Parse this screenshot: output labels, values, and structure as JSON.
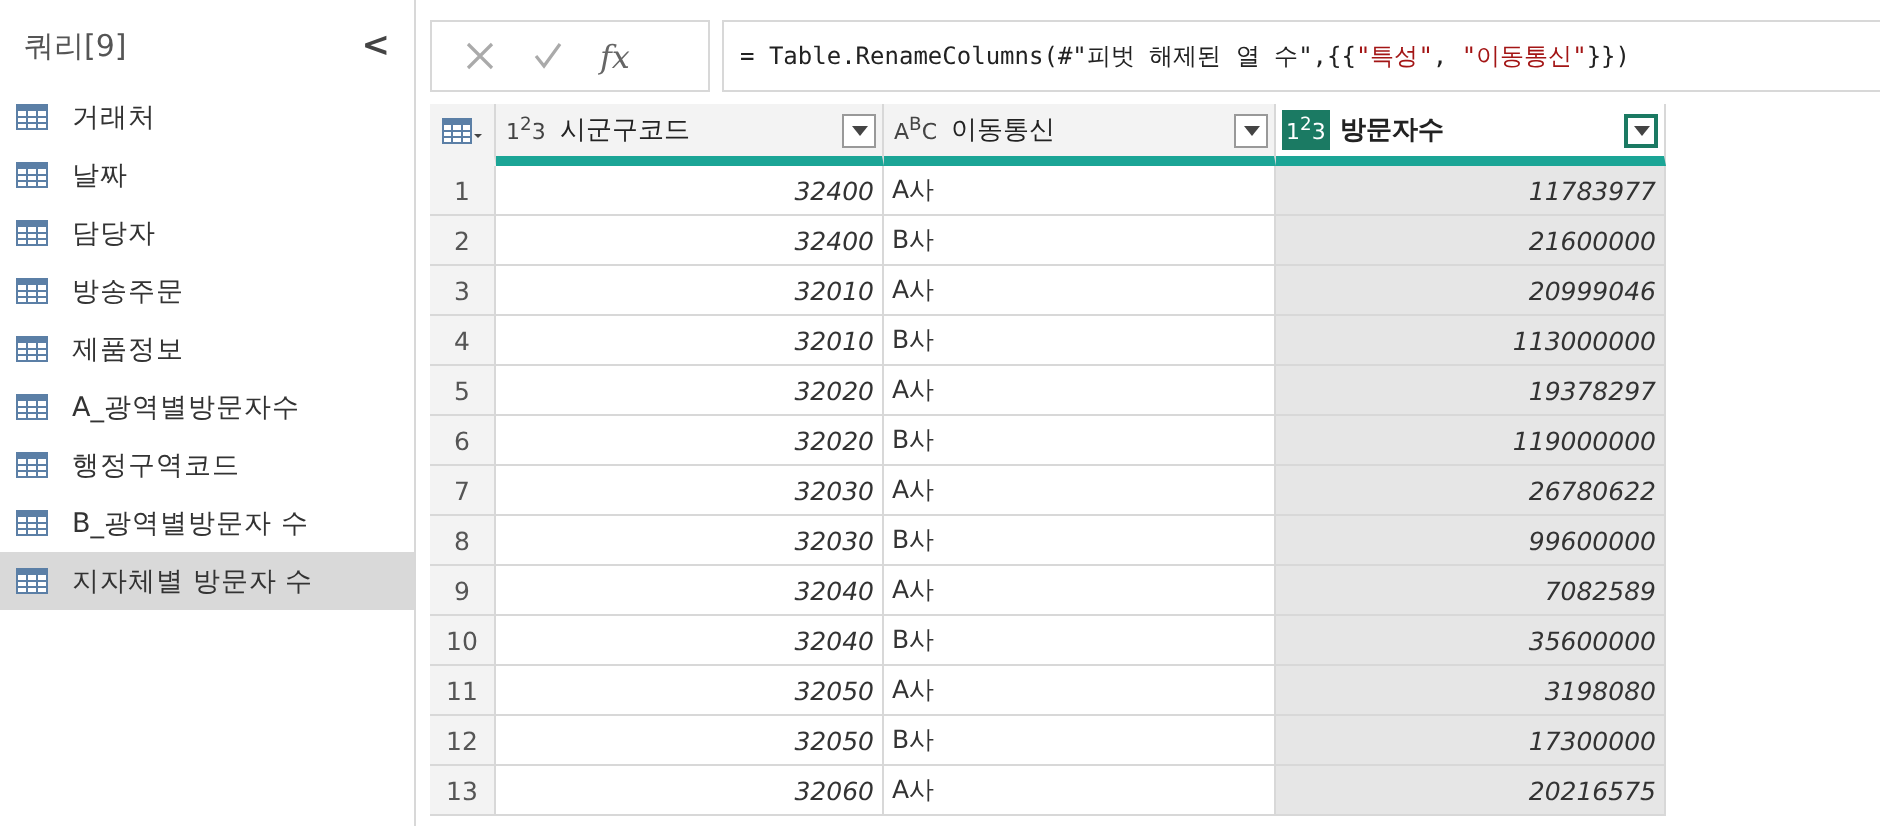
{
  "queries": {
    "title": "쿼리",
    "count": "[9]",
    "collapse": "<",
    "items": [
      {
        "label": "거래처",
        "selected": false
      },
      {
        "label": "날짜",
        "selected": false
      },
      {
        "label": "담당자",
        "selected": false
      },
      {
        "label": "방송주문",
        "selected": false
      },
      {
        "label": "제품정보",
        "selected": false
      },
      {
        "label": "A_광역별방문자수",
        "selected": false
      },
      {
        "label": "행정구역코드",
        "selected": false
      },
      {
        "label": "B_광역별방문자 수",
        "selected": false
      },
      {
        "label": "지자체별 방문자 수",
        "selected": true
      }
    ]
  },
  "formula_bar": {
    "fx": "fx",
    "parts": [
      {
        "kind": "code",
        "text": "= Table.RenameColumns(#\"피벗 해제된 열 수\",{{"
      },
      {
        "kind": "string",
        "text": "\"특성\""
      },
      {
        "kind": "code",
        "text": ", "
      },
      {
        "kind": "string",
        "text": "\"이동통신\""
      },
      {
        "kind": "code",
        "text": "}})"
      }
    ]
  },
  "table": {
    "columns": [
      {
        "type": "1$^{2}$3",
        "name": "시군구코드",
        "kind": "number",
        "selected": false
      },
      {
        "type": "A$^{B}$C",
        "name": "이동통신",
        "kind": "text",
        "selected": false
      },
      {
        "type": "1$^{2}$3",
        "name": "방문자수",
        "kind": "number",
        "selected": true
      }
    ],
    "rows": [
      {
        "number": "1",
        "cells": [
          "32400",
          "A사",
          "11783977"
        ]
      },
      {
        "number": "2",
        "cells": [
          "32400",
          "B사",
          "21600000"
        ]
      },
      {
        "number": "3",
        "cells": [
          "32010",
          "A사",
          "20999046"
        ]
      },
      {
        "number": "4",
        "cells": [
          "32010",
          "B사",
          "113000000"
        ]
      },
      {
        "number": "5",
        "cells": [
          "32020",
          "A사",
          "19378297"
        ]
      },
      {
        "number": "6",
        "cells": [
          "32020",
          "B사",
          "119000000"
        ]
      },
      {
        "number": "7",
        "cells": [
          "32030",
          "A사",
          "26780622"
        ]
      },
      {
        "number": "8",
        "cells": [
          "32030",
          "B사",
          "99600000"
        ]
      },
      {
        "number": "9",
        "cells": [
          "32040",
          "A사",
          "7082589"
        ]
      },
      {
        "number": "10",
        "cells": [
          "32040",
          "B사",
          "35600000"
        ]
      },
      {
        "number": "11",
        "cells": [
          "32050",
          "A사",
          "3198080"
        ]
      },
      {
        "number": "12",
        "cells": [
          "32050",
          "B사",
          "17300000"
        ]
      },
      {
        "number": "13",
        "cells": [
          "32060",
          "A사",
          "20216575"
        ]
      }
    ]
  }
}
